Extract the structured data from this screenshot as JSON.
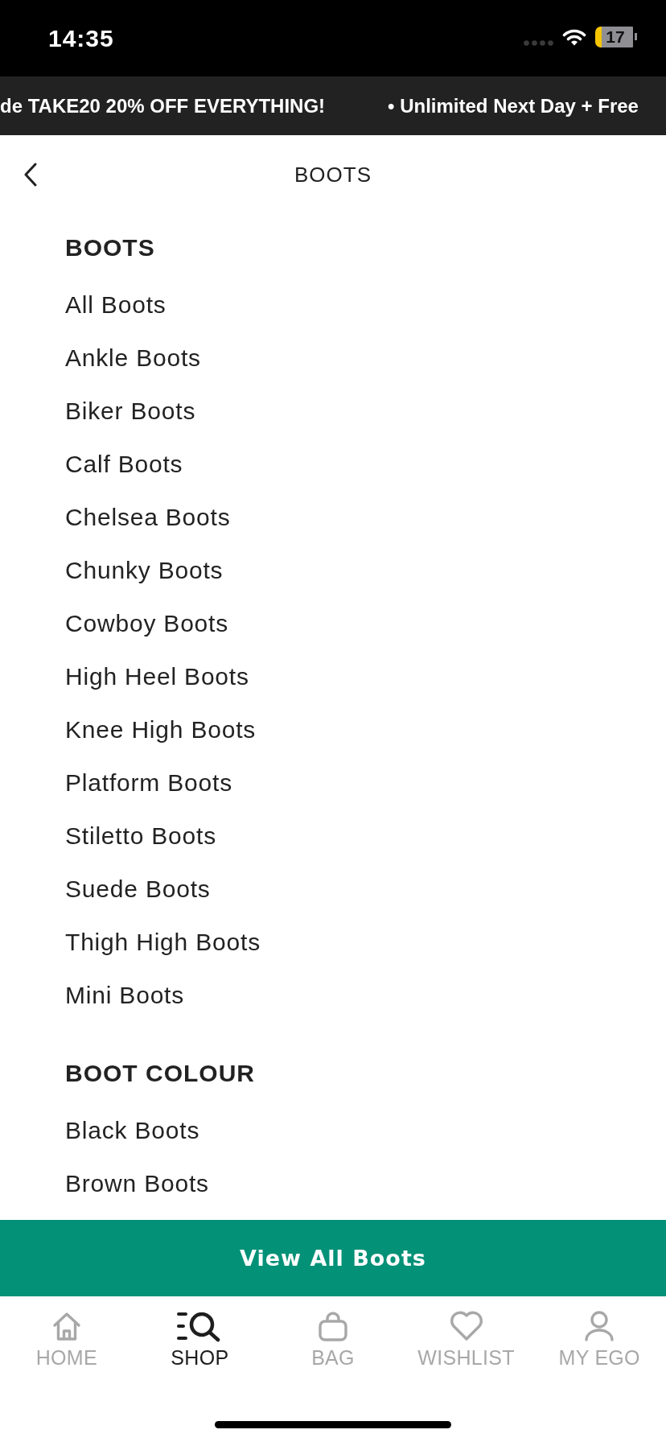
{
  "status_bar": {
    "time": "14:35",
    "battery": "17"
  },
  "promo_banner": {
    "messages": [
      "de TAKE20 20% OFF EVERYTHING!",
      "• Unlimited Next Day + Free"
    ]
  },
  "header": {
    "title": "BOOTS"
  },
  "sections": [
    {
      "heading": "BOOTS",
      "items": [
        "All Boots",
        "Ankle Boots",
        "Biker Boots",
        "Calf Boots",
        "Chelsea Boots",
        "Chunky Boots",
        "Cowboy Boots",
        "High Heel Boots",
        "Knee High Boots",
        "Platform Boots",
        "Stiletto Boots",
        "Suede Boots",
        "Thigh High Boots",
        "Mini Boots"
      ]
    },
    {
      "heading": "BOOT COLOUR",
      "items": [
        "Black Boots",
        "Brown Boots"
      ]
    }
  ],
  "cta_button": {
    "label": "View All Boots"
  },
  "tab_bar": {
    "tabs": [
      {
        "label": "HOME",
        "selected": false
      },
      {
        "label": "SHOP",
        "selected": true
      },
      {
        "label": "BAG",
        "selected": false
      },
      {
        "label": "WISHLIST",
        "selected": false
      },
      {
        "label": "MY EGO",
        "selected": false
      }
    ]
  }
}
